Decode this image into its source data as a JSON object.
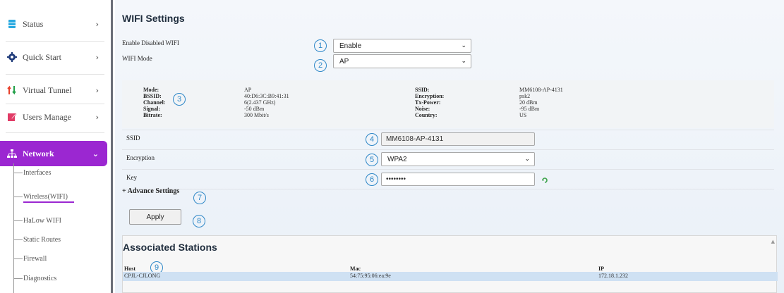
{
  "sidebar": {
    "items": [
      {
        "label": "Status",
        "icon": "status-icon",
        "chevron": "›"
      },
      {
        "label": "Quick Start",
        "icon": "gear-icon",
        "chevron": "›"
      },
      {
        "label": "Virtual Tunnel",
        "icon": "tunnel-icon",
        "chevron": "›"
      },
      {
        "label": "Users Manage",
        "icon": "users-edit-icon",
        "chevron": "›"
      },
      {
        "label": "Network",
        "icon": "network-icon",
        "chevron": "⌄"
      }
    ],
    "sub_items": [
      "Interfaces",
      "Wireless(WIFI)",
      "HaLow WIFI",
      "Static Routes",
      "Firewall",
      "Diagnostics"
    ],
    "accent": "#9b27d1"
  },
  "main": {
    "title": "WIFI Settings",
    "enable_label": "Enable Disabled WIFI",
    "enable_value": "Enable",
    "mode_label": "WIFI Mode",
    "mode_value": "AP",
    "markers": [
      "1",
      "2",
      "3",
      "4",
      "5",
      "6",
      "7",
      "8",
      "9"
    ],
    "info": {
      "left_keys": [
        "Mode:",
        "BSSID:",
        "Channel:",
        "Signal:",
        "Bitrate:"
      ],
      "left_values": [
        "AP",
        "40:D6:3C:B9:41:31",
        "6(2.437 GHz)",
        "-50 dBm",
        "300 Mbit/s"
      ],
      "right_keys": [
        "SSID:",
        "Encryption:",
        "Tx-Power:",
        "Noise:",
        "Country:"
      ],
      "right_values": [
        "MM6108-AP-4131",
        "psk2",
        "20 dBm",
        "-95 dBm",
        "US"
      ]
    },
    "ssid_label": "SSID",
    "ssid_value": "MM6108-AP-4131",
    "encryption_label": "Encryption",
    "encryption_value": "WPA2",
    "key_label": "Key",
    "key_value": "••••••••",
    "advance_label": "+ Advance Settings",
    "apply_label": "Apply"
  },
  "stations": {
    "title": "Associated Stations",
    "headers": [
      "Host",
      "Mac",
      "IP"
    ],
    "rows": [
      {
        "host": "CPJL-CJLONG",
        "mac": "54:75:95:06:ea:9e",
        "ip": "172.18.1.232"
      }
    ]
  }
}
